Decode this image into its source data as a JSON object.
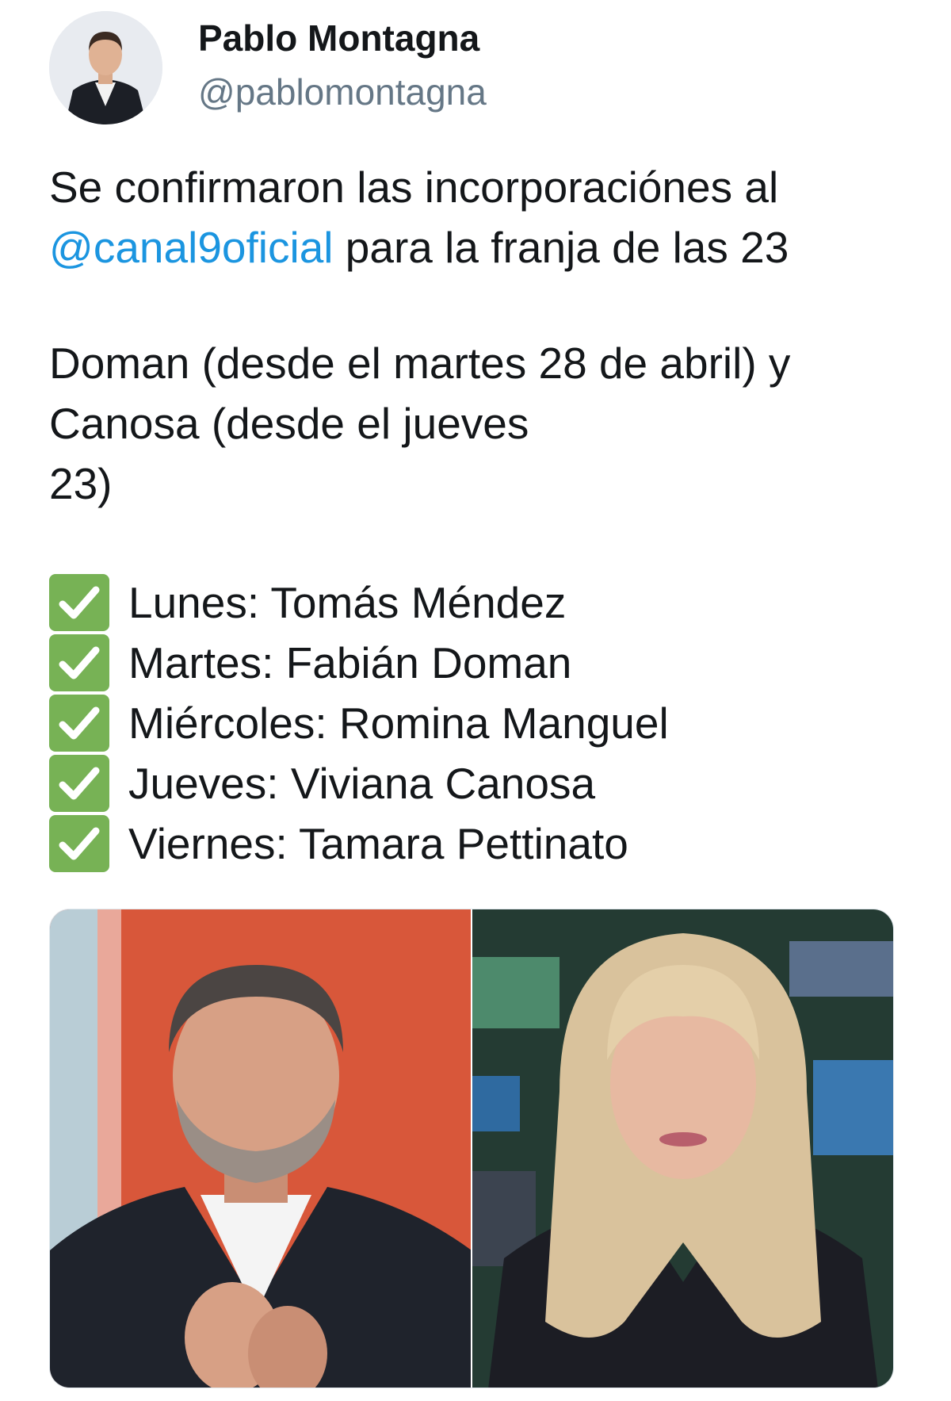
{
  "author": {
    "display_name": "Pablo Montagna",
    "handle": "@pablomontagna"
  },
  "tweet": {
    "paragraph1": {
      "line1": "Se confirmaron las incorporaciónes al",
      "mention": "@canal9oficial",
      "line2_rest": " para la franja de las 23"
    },
    "paragraph2": {
      "line1": "Doman (desde el martes 28 de abril) y",
      "line2": "Canosa (desde el jueves",
      "line3": "23)"
    },
    "schedule": [
      {
        "icon": "check-mark-button-icon",
        "text": "Lunes: Tomás Méndez"
      },
      {
        "icon": "check-mark-button-icon",
        "text": "Martes: Fabián Doman"
      },
      {
        "icon": "check-mark-button-icon",
        "text": "Miércoles: Romina Manguel"
      },
      {
        "icon": "check-mark-button-icon",
        "text": "Jueves: Viviana Canosa"
      },
      {
        "icon": "check-mark-button-icon",
        "text": "Viernes: Tamara Pettinato"
      }
    ]
  },
  "colors": {
    "mention": "#1b95e0",
    "handle": "#657786",
    "check": "#77b255"
  }
}
